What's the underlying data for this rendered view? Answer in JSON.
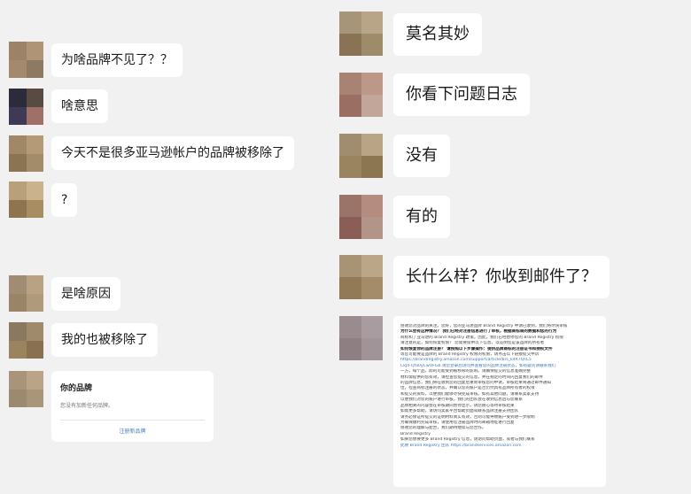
{
  "chat": {
    "left": [
      {
        "text": "为啥品牌不见了？？",
        "avatar": [
          "#9c8266",
          "#b09476",
          "#a48a6c",
          "#8e7a62"
        ]
      },
      {
        "text": "啥意思",
        "avatar": [
          "#2b2b3a",
          "#5a4a44",
          "#3e3a55",
          "#a07068"
        ]
      },
      {
        "text": "今天不是很多亚马逊帐户的品牌被移除了",
        "avatar": [
          "#a08866",
          "#b59a78",
          "#8a7452",
          "#a38c6a"
        ]
      },
      {
        "text": "?",
        "avatar": [
          "#b8a07a",
          "#c9b28c",
          "#8f7450",
          "#a88d62"
        ]
      },
      {
        "text": "是啥原因",
        "avatar": [
          "#a08c72",
          "#b9a283",
          "#9a8468",
          "#b09a7c"
        ]
      },
      {
        "text": "我的也被移除了",
        "avatar": [
          "#8a7860",
          "#a08a6c",
          "#9a845e",
          "#887050"
        ]
      }
    ],
    "card": {
      "title": "你的品牌",
      "body": "您没有加新任何品牌。",
      "link": "注册新品牌",
      "avatar": [
        "#a89478",
        "#b9a487",
        "#9c8a70",
        "#a9957a"
      ]
    },
    "right": [
      {
        "text": "莫名其妙",
        "avatar": [
          "#a79579",
          "#b8a588",
          "#8a7354",
          "#9e8b6a"
        ]
      },
      {
        "text": "你看下问题日志",
        "avatar": [
          "#a88272",
          "#bb9888",
          "#9a6e62",
          "#c2a69a"
        ]
      },
      {
        "text": "没有",
        "avatar": [
          "#a08c6e",
          "#b9a486",
          "#9a8460",
          "#8c7652"
        ]
      },
      {
        "text": "有的",
        "avatar": [
          "#9a7468",
          "#b48c80",
          "#8a5e56",
          "#b29488"
        ]
      },
      {
        "text": "长什么样？你收到邮件了？",
        "avatar": [
          "#a89474",
          "#bba687",
          "#927a56",
          "#a48c6a"
        ]
      }
    ],
    "doc": {
      "avatar": [
        "#9a8c8e",
        "#a99ca0",
        "#8e8082",
        "#a19498"
      ],
      "lines": [
        "感谢您对品牌的关注。您好，您的亚马逊品牌 Brand Registry 申请已收到，我们将尽快审核",
        "为什么会有这种情况？ 我们已经对注册信息进行了审核，根据商标局的数据和您的行为",
        "商标和了亚马逊的 Brand Registry 政策，因此，我们已经暂停您的 Brand Registry 权限",
        "请注意的是，如何恢复权限？ 您需要提供以下信息，以证明您是该品牌的所有者",
        "如何恢复你的品牌注册？ 请按照以下步骤操作：提供品牌商标的注册证书和授权文件",
        "等您可能要是品牌的 Brand Registry 权限的权限，请点击以下链接提交申诉",
        "https://brandregistry.amazon.com/support/article/brs_k4R7QsC5",
        "CkJ4-Qfa0yCwOFGb    请您登录后访问并查看您的品牌注册状态，如有疑问请联系我们",
        "一方，每个品，即的可能受到被移除的影响。请确保提交的信息准确完整",
        "材料需提供的您有效，请检查您提交的信息，并在规定的时间内回复我们的邮件",
        "的品牌信息，我们将在收到您的回复后重新审核您的申请，审核结果将通过邮件通知",
        "位，检查商标注册的状态，并确认您的账户是否仍然具有品牌所有者的权限",
        "和提交的资料，以便我们能够尽快完成审核。如有其他问题，请联系卖家支持",
        "以便我们对您的账户进行审核，我们的团队会在收到信息后与您联系",
        "品牌相关的内容会在审核期间暂停显示，请您耐心等待审核结果",
        "如需更多帮助，请访问卖家平台帮助页面或联系品牌注册支持团队",
        "请务必保证所提交的证明材料真实有效，否则可能导致账户受到进一步限制",
        "为确保顺利完成审核，请使用您注册品牌时的邮箱地址进行回复",
        "感谢您的理解与配合，我们期待继续与您合作。",
        "Brand Registry",
        "如果您想要更多 Brand Registry 信息，请访问帮助页面，或者与我们联系",
        "此致 Brand Registry 团队    https://brandservices.amazon.com"
      ]
    }
  }
}
